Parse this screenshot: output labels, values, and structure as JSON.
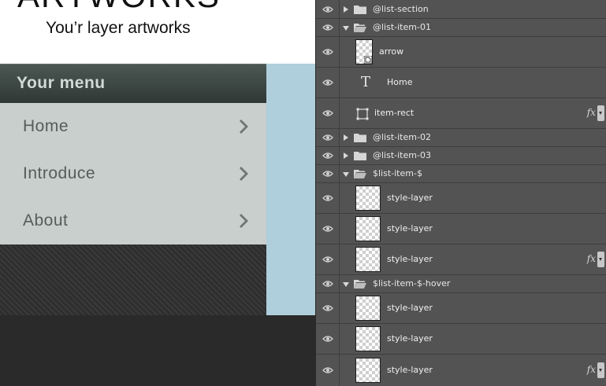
{
  "artwork": {
    "title": "ARTWORKS",
    "subtitle": "You’r layer artworks",
    "menu_header": "Your menu",
    "menu_items": [
      {
        "label": "Home",
        "arrow_icon": "chevron-right-icon"
      },
      {
        "label": "Introduce",
        "arrow_icon": "chevron-right-icon"
      },
      {
        "label": "About",
        "arrow_icon": "chevron-right-icon"
      }
    ],
    "colors": {
      "menu_header_bg": "#3b4543",
      "menu_items_bg": "#c9cfcd",
      "accent_blue": "#aecfdb"
    }
  },
  "layers": {
    "groups": [
      {
        "name": "@list-section",
        "expanded": false
      },
      {
        "name": "@list-item-01",
        "expanded": true
      },
      {
        "name": "@list-item-02",
        "expanded": false
      },
      {
        "name": "@list-item-03",
        "expanded": false
      },
      {
        "name": "$list-item-$",
        "expanded": true
      },
      {
        "name": "$list-item-$-hover",
        "expanded": true
      }
    ],
    "list_item_01_layers": [
      {
        "name": "arrow",
        "kind": "smart-object",
        "fx": false
      },
      {
        "name": "Home",
        "kind": "text",
        "fx": false
      },
      {
        "name": "item-rect",
        "kind": "shape",
        "fx": true
      }
    ],
    "list_item_layers": [
      {
        "name": "style-layer",
        "fx": false
      },
      {
        "name": "style-layer",
        "fx": false
      },
      {
        "name": "style-layer",
        "fx": true
      }
    ],
    "list_item_hover_layers": [
      {
        "name": "style-layer",
        "fx": false
      },
      {
        "name": "style-layer",
        "fx": false
      },
      {
        "name": "style-layer",
        "fx": true
      }
    ],
    "fx_label": "fx",
    "text_layer_glyph": "T"
  }
}
